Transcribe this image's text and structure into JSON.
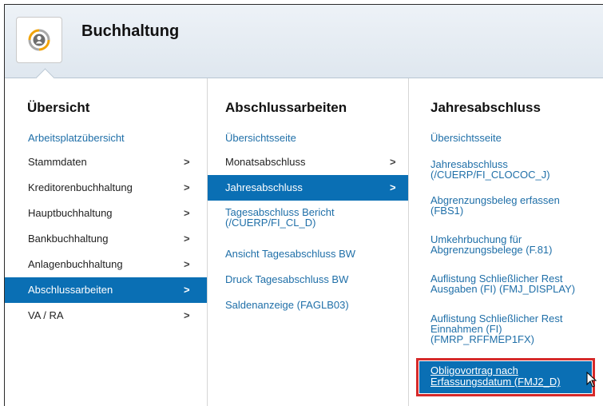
{
  "header": {
    "title": "Buchhaltung",
    "icon": "accounting-user-cycle-icon"
  },
  "col1": {
    "title": "Übersicht",
    "items": [
      {
        "label": "Arbeitsplatzübersicht"
      },
      {
        "label": "Stammdaten",
        "chevron": ">"
      },
      {
        "label": "Kreditorenbuchhaltung",
        "chevron": ">"
      },
      {
        "label": "Hauptbuchhaltung",
        "chevron": ">"
      },
      {
        "label": "Bankbuchhaltung",
        "chevron": ">"
      },
      {
        "label": "Anlagenbuchhaltung",
        "chevron": ">"
      },
      {
        "label": "Abschlussarbeiten",
        "chevron": ">"
      },
      {
        "label": "VA / RA",
        "chevron": ">"
      }
    ]
  },
  "col2": {
    "title": "Abschlussarbeiten",
    "items": [
      {
        "label": "Übersichtsseite"
      },
      {
        "label": "Monatsabschluss",
        "chevron": ">"
      },
      {
        "label": "Jahresabschluss",
        "chevron": ">"
      },
      {
        "label": "Tagesabschluss Bericht\n(/CUERP/FI_CL_D)"
      },
      {
        "label": "Ansicht Tagesabschluss BW"
      },
      {
        "label": "Druck Tagesabschluss BW"
      },
      {
        "label": "Saldenanzeige (FAGLB03)"
      }
    ]
  },
  "col3": {
    "title": "Jahresabschluss",
    "items": [
      {
        "label": "Übersichtsseite"
      },
      {
        "label": "Jahresabschluss\n(/CUERP/FI_CLOCOC_J)"
      },
      {
        "label": "Abgrenzungsbeleg erfassen\n(FBS1)"
      },
      {
        "label": "Umkehrbuchung für\nAbgrenzungsbelege (F.81)"
      },
      {
        "label": "Auflistung Schließlicher Rest\nAusgaben (FI) (FMJ_DISPLAY)"
      },
      {
        "label": "Auflistung Schließlicher Rest\nEinnahmen (FI)\n(FMRP_RFFMEP1FX)"
      },
      {
        "label": "Obligovortrag nach\nErfassungsdatum (FMJ2_D)"
      }
    ]
  },
  "colors": {
    "accent": "#0a6fb4",
    "link": "#1f6fa8",
    "highlight": "#d62a2a"
  }
}
